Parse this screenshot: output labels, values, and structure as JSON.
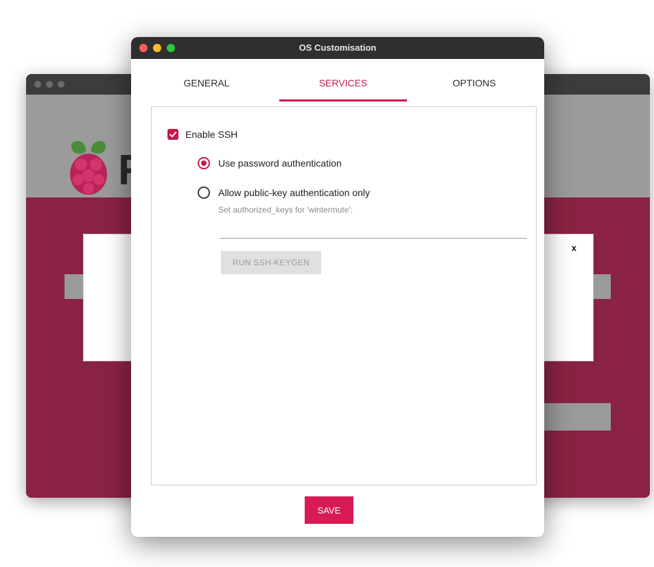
{
  "background_window": {
    "logo_text": "R",
    "dialog_close": "x"
  },
  "dialog": {
    "title": "OS Customisation",
    "tabs": [
      {
        "label": "GENERAL",
        "active": false
      },
      {
        "label": "SERVICES",
        "active": true
      },
      {
        "label": "OPTIONS",
        "active": false
      }
    ],
    "ssh": {
      "enable_label": "Enable SSH",
      "enabled": true,
      "password_auth_label": "Use password authentication",
      "password_auth_selected": true,
      "pubkey_auth_label": "Allow public-key authentication only",
      "pubkey_auth_selected": false,
      "authorized_keys_hint": "Set authorized_keys for 'wintermute':",
      "authorized_keys_value": "",
      "keygen_button": "RUN SSH-KEYGEN"
    },
    "save_button": "SAVE"
  },
  "colors": {
    "accent": "#c51a4a",
    "save_button": "#d81b55",
    "background_body": "#8a2343",
    "titlebar": "#2f2f2f"
  },
  "icons": [
    "checkbox-checked-icon",
    "radio-selected-icon",
    "radio-unselected-icon",
    "raspberry-logo-icon"
  ]
}
